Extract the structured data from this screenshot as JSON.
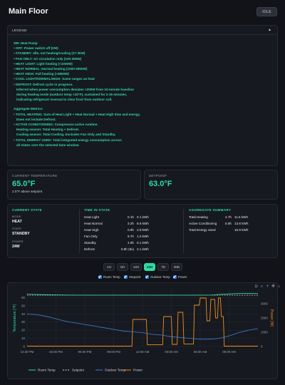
{
  "header": {
    "title": "Main Floor",
    "status_badge": "IDLE"
  },
  "legend": {
    "title": "LEGEND",
    "collapse_icon": "chevron-up-icon",
    "lines": [
      "30K Heat Pump",
      "• OFF: Power switch off (0W)",
      "• STANDBY: Idle, not heating/cooling (17-30W)",
      "• FAN ONLY: Air circulation only (100-350W)",
      "• HEAT LIGHT: Light heating (<1000W)",
      "• HEAT NORMAL: Normal heating (1000-2800W)",
      "• HEAT HIGH: Full heating (>2800W)",
      "• COOL LIGHT/NORMAL/HIGH: Same ranges as heat",
      "• DEFROST: Defrost cycle in progress.",
      "Inferred when power consumption deviates >200W from 10-minute baseline",
      "during heating mode (outdoor temp <40°F), sustained for 2-15 minutes,",
      "indicating refrigerant reversal to clear frost from outdoor coil.",
      "Aggregate Metrics:",
      "• TOTAL HEATING: Sum of Heat Light + Heat Normal + Heat High time and energy.",
      "Does not include Defrost.",
      "• ACTIVE CONDITIONING: Compressor-active runtime.",
      "Heating season: Total Heating + Defrost.",
      "Cooling season: Total Cooling. Excludes Fan Only and Standby.",
      "• TOTAL ENERGY USED: Total integrated energy consumption across",
      "all states over the selected time window."
    ]
  },
  "current_temperature": {
    "label": "CURRENT TEMPERATURE",
    "value": "65.0°F",
    "delta": "2.0°F above setpoint"
  },
  "setpoint": {
    "label": "SETPOINT",
    "value": "63.0°F"
  },
  "current_state": {
    "title": "CURRENT STATE",
    "mode_label": "MODE",
    "mode": "HEAT",
    "state_label": "STATE",
    "state": "STANDBY",
    "power_label": "POWER",
    "power": "24W"
  },
  "time_in_state": {
    "title": "TIME IN STATE",
    "rows": [
      {
        "state": "Heat Light",
        "time": "0.1h",
        "energy": "0.1 kWh"
      },
      {
        "state": "Heat Normal",
        "time": "3.2h",
        "energy": "8.6 kWh"
      },
      {
        "state": "Heat High",
        "time": "0.9h",
        "energy": "2.9 kWh"
      },
      {
        "state": "Fan Only",
        "time": "9.7h",
        "energy": "1.0 kWh"
      },
      {
        "state": "Standby",
        "time": "4.9h",
        "energy": "0.1 kWh"
      },
      {
        "state": "Defrost",
        "time": "0.8h (6x)",
        "energy": "2.1 kWh"
      }
    ]
  },
  "aggregate_summary": {
    "title": "AGGREGATE SUMMARY",
    "rows": [
      {
        "label": "Total Heating",
        "time": "4.7h",
        "energy": "11.6 kWh"
      },
      {
        "label": "Active Conditioning",
        "time": "5.5h",
        "energy": "13.6 kWh"
      },
      {
        "label": "Total Energy Used",
        "time": "",
        "energy": "15.9 kWh"
      }
    ]
  },
  "range_buttons": [
    "1H",
    "6H",
    "12H",
    "24H",
    "7D",
    "30D"
  ],
  "active_range": "24H",
  "series_toggles": [
    "Room Temp",
    "Setpoint",
    "Outdoor Temp",
    "Power"
  ],
  "toolbar_icons": [
    "camera-icon",
    "zoom-icon",
    "plus-icon",
    "pan-icon",
    "home-icon",
    "zoom-out-icon"
  ],
  "chart_data": {
    "type": "line",
    "ylabel": "Temperature (°F)",
    "y2label": "Power (W)",
    "ylim": [
      0,
      70
    ],
    "y2lim": [
      0,
      4000
    ],
    "yticks": [
      0,
      10,
      20,
      30,
      40,
      50,
      60
    ],
    "y2ticks": [
      0,
      1000,
      2000,
      3000
    ],
    "xlim": [
      0,
      24
    ],
    "xticks": [
      {
        "t": 0,
        "label": "12:30 PM"
      },
      {
        "t": 3,
        "label": "03:00 PM"
      },
      {
        "t": 6,
        "label": "06:00 PM"
      },
      {
        "t": 9,
        "label": "09:00 PM"
      },
      {
        "t": 12,
        "label": "12:00 AM"
      },
      {
        "t": 15,
        "label": "03:00 AM"
      },
      {
        "t": 18,
        "label": "06:00 AM"
      },
      {
        "t": 21,
        "label": "09:00 AM"
      }
    ],
    "grid": true,
    "legend_position": "bottom",
    "series": [
      {
        "name": "Room Temp",
        "axis": "y",
        "color": "#2fdba3",
        "dash": false,
        "x": [
          0,
          1,
          2,
          3,
          4,
          5,
          6,
          7,
          8,
          9,
          10,
          11,
          12,
          13,
          14,
          15,
          16,
          17,
          18,
          19,
          20,
          21,
          22,
          23,
          24
        ],
        "y": [
          64.2,
          63.9,
          63.6,
          63.4,
          63.2,
          63.1,
          63.1,
          63.0,
          63.0,
          63.0,
          63.1,
          63.0,
          63.1,
          63.0,
          63.0,
          63.1,
          63.0,
          63.0,
          63.1,
          63.0,
          64.0,
          64.6,
          65.0,
          65.2,
          65.0
        ]
      },
      {
        "name": "Setpoint",
        "axis": "y",
        "color": "#cfd4da",
        "dash": true,
        "x": [
          0,
          24
        ],
        "y": [
          63.0,
          63.0
        ]
      },
      {
        "name": "Outdoor Temp",
        "axis": "y",
        "color": "#3f7fe0",
        "dash": false,
        "x": [
          0,
          1,
          2,
          3,
          4,
          5,
          6,
          7,
          8,
          9,
          10,
          11,
          12,
          13,
          14,
          15,
          16,
          17,
          18,
          19,
          20,
          21,
          22,
          23,
          24
        ],
        "y": [
          40,
          39,
          37,
          34,
          31,
          29,
          27,
          25,
          23,
          21,
          19,
          18,
          17,
          15,
          14,
          12,
          11,
          10,
          9,
          9,
          10,
          13,
          17,
          20,
          22
        ]
      },
      {
        "name": "Power",
        "axis": "y2",
        "color": "#f28a1e",
        "dash": false,
        "x": [
          0,
          10.9,
          11.0,
          12.4,
          12.5,
          14.1,
          14.2,
          15.0,
          15.1,
          15.6,
          15.7,
          16.2,
          16.3,
          17.3,
          17.4,
          17.9,
          18.0,
          18.6,
          18.7,
          19.0,
          19.1,
          19.5,
          19.6,
          19.8,
          19.9,
          20.1,
          20.2,
          20.4,
          20.5,
          24
        ],
        "y": [
          25,
          25,
          1900,
          1900,
          120,
          120,
          2100,
          2100,
          150,
          150,
          2400,
          2400,
          180,
          180,
          2900,
          2900,
          3400,
          3400,
          1800,
          1800,
          3300,
          3300,
          2000,
          2000,
          3400,
          3400,
          2100,
          2100,
          25,
          25
        ]
      }
    ]
  }
}
